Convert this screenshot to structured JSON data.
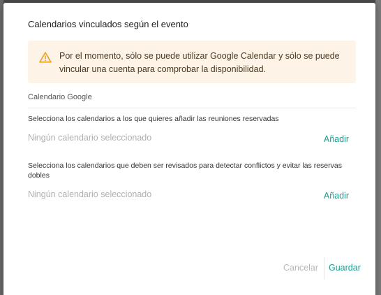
{
  "dialog": {
    "title": "Calendarios vinculados según el evento",
    "warning": {
      "icon": "warning-icon",
      "text": "Por el momento, sólo se puede utilizar Google Calendar y sólo se puede vincular una cuenta para comprobar la disponibilidad."
    },
    "section_label": "Calendario Google",
    "booking": {
      "description": "Selecciona los calendarios a los que quieres añadir las reuniones reservadas",
      "empty_text": "Ningún calendario seleccionado",
      "add_label": "Añadir"
    },
    "conflicts": {
      "description": "Selecciona los calendarios que deben ser revisados para detectar conflictos y evitar las reservas dobles",
      "empty_text": "Ningún calendario seleccionado",
      "add_label": "Añadir"
    },
    "footer": {
      "cancel_label": "Cancelar",
      "save_label": "Guardar"
    }
  },
  "colors": {
    "accent": "#1a9e8f",
    "warning_bg": "#fdf3e6",
    "warning_icon": "#f0a020"
  }
}
